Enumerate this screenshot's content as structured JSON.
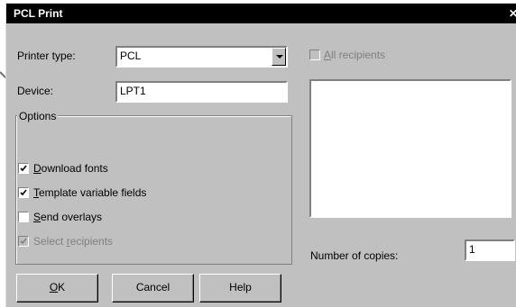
{
  "window": {
    "title": "PCL Print",
    "close_icon": "close-icon"
  },
  "printer_type": {
    "label": "Printer type:",
    "value": "PCL"
  },
  "device": {
    "label": "Device:",
    "value": "LPT1"
  },
  "options": {
    "legend": "Options",
    "items": [
      {
        "label": "Download fonts",
        "accel": "D",
        "rest": "ownload fonts",
        "checked": true,
        "enabled": true
      },
      {
        "label": "Template variable fields",
        "accel": "T",
        "rest": "emplate variable fields",
        "checked": true,
        "enabled": true
      },
      {
        "label": "Send overlays",
        "accel": "S",
        "rest": "end overlays",
        "checked": false,
        "enabled": true
      },
      {
        "label": "Select recipients",
        "pre": "Select ",
        "accel": "r",
        "rest": "ecipients",
        "checked": true,
        "enabled": false
      }
    ]
  },
  "all_recipients": {
    "label": "All recipients",
    "accel": "A",
    "rest": "ll recipients",
    "checked": false,
    "enabled": false
  },
  "copies": {
    "label": "Number of copies:",
    "value": "1"
  },
  "buttons": {
    "ok": "OK",
    "ok_accel": "O",
    "ok_rest": "K",
    "cancel": "Cancel",
    "help": "Help"
  }
}
